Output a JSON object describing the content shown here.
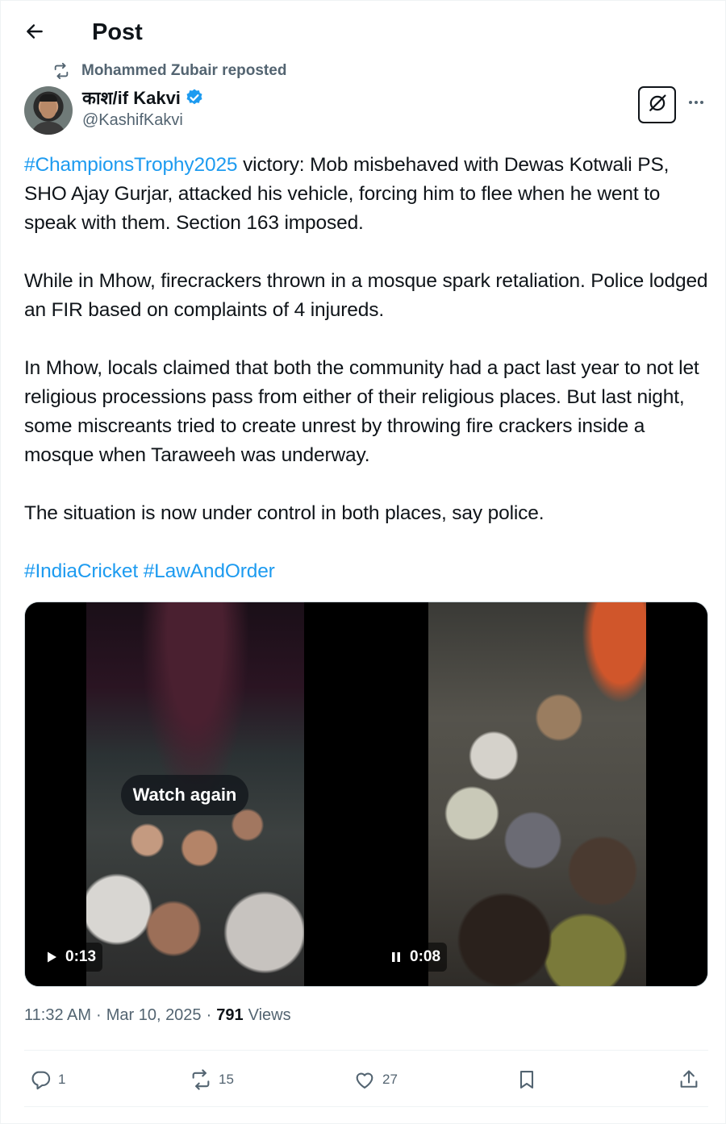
{
  "header": {
    "title": "Post"
  },
  "repost": {
    "text": "Mohammed Zubair reposted",
    "icon": "repost-icon"
  },
  "author": {
    "display_name": "काश/if Kakvi",
    "handle": "@KashifKakvi",
    "verified": true,
    "verified_color": "#1d9bf0"
  },
  "post": {
    "paragraphs": [
      [
        {
          "hashtag": true,
          "text": "#ChampionsTrophy2025"
        },
        {
          "hashtag": false,
          "text": " victory: Mob misbehaved with Dewas Kotwali PS, SHO Ajay Gurjar, attacked his vehicle, forcing him to flee when he went to speak with them. Section 163 imposed."
        }
      ],
      [
        {
          "hashtag": false,
          "text": "While in Mhow, firecrackers thrown in a mosque spark retaliation. Police lodged an FIR based on complaints of 4 injureds."
        }
      ],
      [
        {
          "hashtag": false,
          "text": "In Mhow, locals claimed that both the community had a pact last year to not let religious processions pass from either of their religious places. But last night, some miscreants tried to create unrest by throwing fire crackers inside a mosque when Taraweeh was underway."
        }
      ],
      [
        {
          "hashtag": false,
          "text": "The situation is now under control in both places, say police."
        }
      ],
      [
        {
          "hashtag": true,
          "text": "#IndiaCricket"
        },
        {
          "hashtag": false,
          "text": " "
        },
        {
          "hashtag": true,
          "text": "#LawAndOrder"
        }
      ]
    ],
    "hashtag_color": "#1d9bf0"
  },
  "media": {
    "videos": [
      {
        "overlay_label": "Watch again",
        "control_icon": "play-icon",
        "duration": "0:13"
      },
      {
        "overlay_label": "",
        "control_icon": "pause-icon",
        "duration": "0:08"
      }
    ]
  },
  "meta": {
    "time": "11:32 AM",
    "sep1": "·",
    "date": "Mar 10, 2025",
    "sep2": "·",
    "views_count": "791",
    "views_label": "Views"
  },
  "actions": {
    "reply": {
      "icon": "reply-icon",
      "count": "1"
    },
    "repost": {
      "icon": "repost-icon",
      "count": "15"
    },
    "like": {
      "icon": "heart-icon",
      "count": "27"
    },
    "bookmark": {
      "icon": "bookmark-icon"
    },
    "share": {
      "icon": "share-icon"
    }
  },
  "colors": {
    "text": "#0f1419",
    "secondary": "#536471",
    "accent": "#1d9bf0",
    "border": "#eff3f4"
  }
}
